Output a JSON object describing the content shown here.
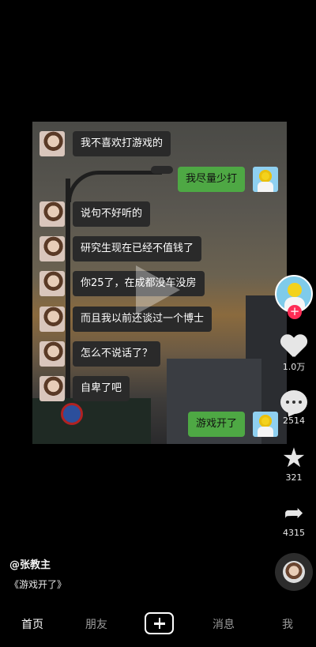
{
  "video": {
    "chat_left_messages": [
      "我不喜欢打游戏的",
      "说句不好听的",
      "研究生现在已经不值钱了",
      "你25了，在成都没车没房",
      "而且我以前还谈过一个博士",
      "怎么不说话了？",
      "自卑了吧"
    ],
    "chat_right_messages": [
      "我尽量少打",
      "游戏开了"
    ]
  },
  "actions": {
    "like_count": "1.0万",
    "comment_count": "2514",
    "favorite_count": "321",
    "share_count": "4315"
  },
  "post": {
    "author": "@张教主",
    "caption": "《游戏开了》"
  },
  "nav": {
    "home": "首页",
    "friends": "朋友",
    "messages": "消息",
    "me": "我"
  },
  "colors": {
    "chat_green": "#4ea844",
    "follow_red": "#fe2c55"
  }
}
